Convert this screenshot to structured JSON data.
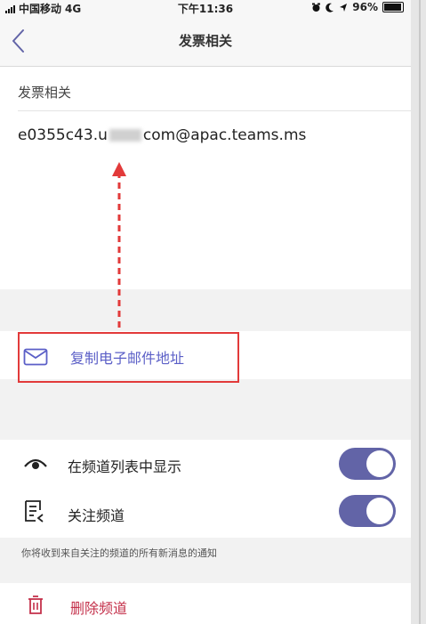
{
  "status_bar": {
    "carrier": "中国移动",
    "network": "4G",
    "time": "下午11:36",
    "battery": "96%"
  },
  "nav": {
    "title": "发票相关"
  },
  "channel": {
    "name": "发票相关",
    "email_prefix": "e0355c43.u",
    "email_suffix": "com@apac.teams.ms"
  },
  "actions": {
    "copy_email": "复制电子邮件地址",
    "show_in_list": "在频道列表中显示",
    "show_in_list_on": true,
    "follow_channel": "关注频道",
    "follow_channel_on": true,
    "follow_note": "你将收到来自关注的频道的所有新消息的通知",
    "delete_channel": "删除频道"
  },
  "colors": {
    "accent": "#6264a7",
    "danger": "#c4314b",
    "highlight": "#e23a3a"
  }
}
